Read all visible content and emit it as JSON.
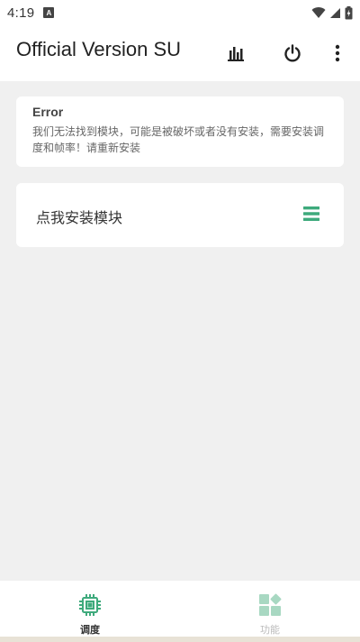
{
  "status_bar": {
    "time": "4:19",
    "app_icon_letter": "A"
  },
  "app_bar": {
    "title": "Official Version SU"
  },
  "error_card": {
    "title": "Error",
    "message": "我们无法找到模块，可能是被破坏或者没有安装，需要安装调度和帧率！请重新安装"
  },
  "install_card": {
    "label": "点我安装模块"
  },
  "bottom_nav": {
    "items": [
      {
        "label": "调度",
        "icon": "cpu-chip-icon",
        "active": true
      },
      {
        "label": "功能",
        "icon": "features-icon",
        "active": false
      }
    ]
  },
  "colors": {
    "accent": "#3eaa7c",
    "accent_light": "#a8d8c2",
    "background": "#f0f0f0",
    "card": "#ffffff"
  }
}
